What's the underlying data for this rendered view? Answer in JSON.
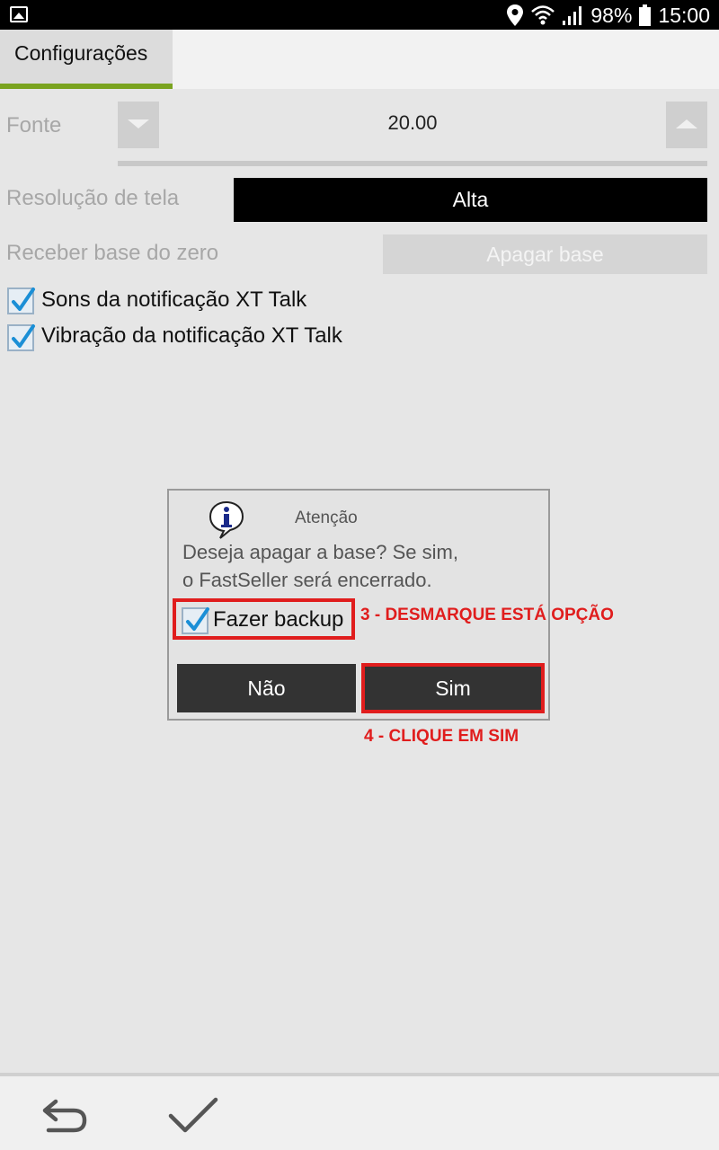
{
  "status_bar": {
    "battery": "98%",
    "time": "15:00"
  },
  "tab": {
    "label": "Configurações",
    "accent_color": "#7aa31f"
  },
  "settings": {
    "font_label": "Fonte",
    "font_value": "20.00",
    "resolution_label": "Resolução de tela",
    "resolution_value": "Alta",
    "base_label": "Receber base do zero",
    "base_button": "Apagar base",
    "checkboxes": [
      {
        "label": "Sons da notificação XT Talk",
        "checked": true
      },
      {
        "label": "Vibração da notificação XT Talk",
        "checked": true
      }
    ]
  },
  "dialog": {
    "title": "Atenção",
    "message_line1": "Deseja apagar a base? Se sim,",
    "message_line2": "o FastSeller será encerrado.",
    "backup_label": "Fazer backup",
    "backup_checked": true,
    "no_button": "Não",
    "yes_button": "Sim"
  },
  "annotations": {
    "step3": "3 - DESMARQUE ESTÁ OPÇÃO",
    "step4": "4 - CLIQUE EM SIM",
    "color": "#e01d1d"
  },
  "bottom_bar": {
    "icons": [
      "undo-icon",
      "check-icon"
    ]
  }
}
